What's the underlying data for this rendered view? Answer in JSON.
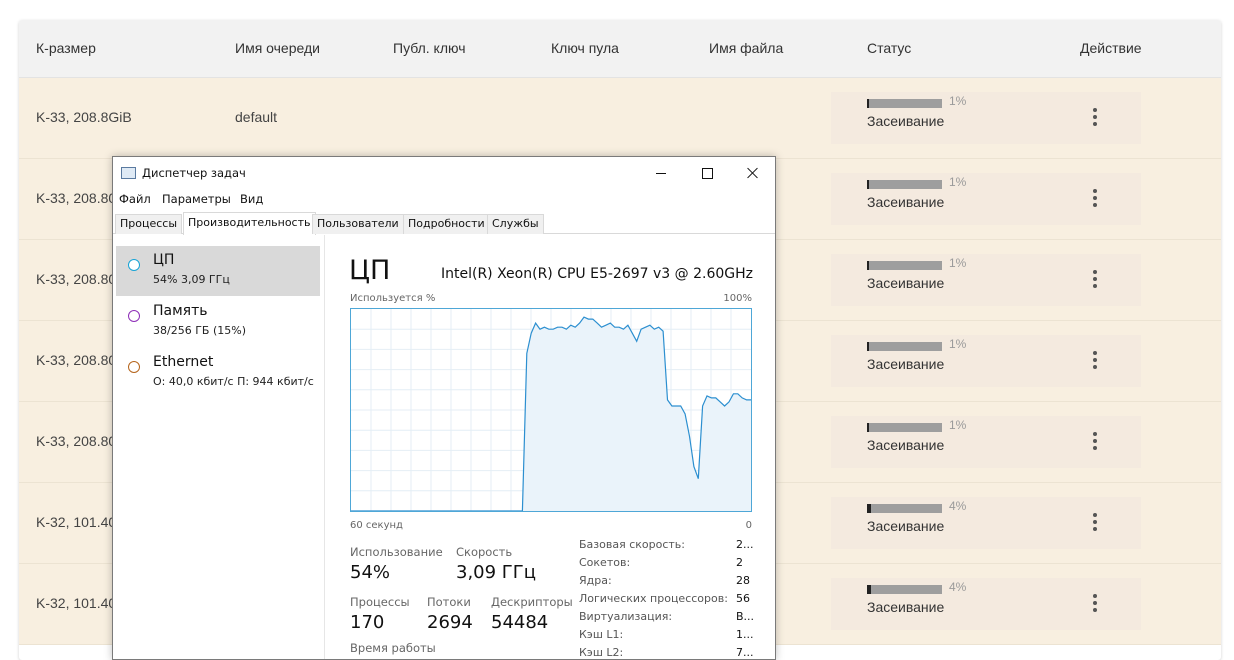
{
  "table": {
    "headers": [
      "К-размер",
      "Имя очереди",
      "Публ. ключ",
      "Ключ пула",
      "Имя файла",
      "Статус",
      "Действие"
    ],
    "rows": [
      {
        "size": "K-33, 208.8GiB",
        "queue": "default",
        "pct": "1%",
        "progress": 0.01,
        "status": "Засеивание"
      },
      {
        "size": "K-33, 208.80",
        "queue": "",
        "pct": "1%",
        "progress": 0.01,
        "status": "Засеивание"
      },
      {
        "size": "K-33, 208.80",
        "queue": "",
        "pct": "1%",
        "progress": 0.01,
        "status": "Засеивание"
      },
      {
        "size": "K-33, 208.80",
        "queue": "",
        "pct": "1%",
        "progress": 0.01,
        "status": "Засеивание"
      },
      {
        "size": "K-33, 208.80",
        "queue": "",
        "pct": "1%",
        "progress": 0.01,
        "status": "Засеивание"
      },
      {
        "size": "K-32, 101.40",
        "queue": "",
        "pct": "4%",
        "progress": 0.04,
        "status": "Засеивание"
      },
      {
        "size": "K-32, 101.40",
        "queue": "",
        "pct": "4%",
        "progress": 0.04,
        "status": "Засеивание"
      }
    ]
  },
  "taskmgr": {
    "title": "Диспетчер задач",
    "menu": [
      "Файл",
      "Параметры",
      "Вид"
    ],
    "tabs": [
      "Процессы",
      "Производительность",
      "Пользователи",
      "Подробности",
      "Службы"
    ],
    "active_tab": 1,
    "resources": [
      {
        "name": "ЦП",
        "sub": "54%  3,09 ГГц",
        "color": "#17a3d6"
      },
      {
        "name": "Память",
        "sub": "38/256 ГБ (15%)",
        "color": "#8e2fb8"
      },
      {
        "name": "Ethernet",
        "sub": "О: 40,0 кбит/с  П: 944 кбит/с",
        "color": "#b5651d"
      }
    ],
    "cpu_title": "ЦП",
    "cpu_name": "Intel(R) Xeon(R) CPU E5-2697 v3 @ 2.60GHz",
    "graph_label": "Используется %",
    "graph_max": "100%",
    "graph_time": "60 секунд",
    "graph_min": "0",
    "usage_label": "Использование",
    "usage_value": "54%",
    "speed_label": "Скорость",
    "speed_value": "3,09 ГГц",
    "processes_label": "Процессы",
    "processes_value": "170",
    "threads_label": "Потоки",
    "threads_value": "2694",
    "handles_label": "Дескрипторы",
    "handles_value": "54484",
    "uptime_label": "Время работы",
    "details": [
      {
        "k": "Базовая скорость:",
        "v": "2..."
      },
      {
        "k": "Сокетов:",
        "v": "2"
      },
      {
        "k": "Ядра:",
        "v": "28"
      },
      {
        "k": "Логических процессоров:",
        "v": "56"
      },
      {
        "k": "Виртуализация:",
        "v": "В..."
      },
      {
        "k": "Кэш L1:",
        "v": "1..."
      },
      {
        "k": "Кэш L2:",
        "v": "7..."
      }
    ],
    "cpu_history": [
      0,
      0,
      0,
      0,
      0,
      0,
      0,
      0,
      0,
      0,
      0,
      0,
      0,
      0,
      0,
      0,
      0,
      0,
      0,
      0,
      0,
      0,
      0,
      0,
      0,
      0,
      0,
      0,
      0,
      0,
      0,
      0,
      0,
      0,
      0,
      0,
      0,
      0,
      0,
      0,
      78,
      88,
      93,
      90,
      91,
      90,
      90,
      91,
      91,
      90,
      92,
      91,
      93,
      96,
      95,
      95,
      93,
      91,
      92,
      93,
      91,
      91,
      90,
      92,
      88,
      84,
      90,
      91,
      92,
      90,
      91,
      89,
      55,
      52,
      52,
      52,
      48,
      37,
      22,
      16,
      52,
      57,
      56,
      56,
      54,
      52,
      54,
      58,
      58,
      56,
      55,
      55
    ]
  }
}
